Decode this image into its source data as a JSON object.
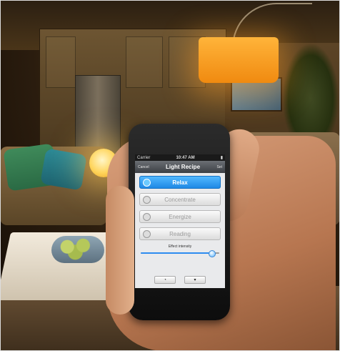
{
  "status_bar": {
    "carrier": "Carrier",
    "time": "10:47 AM"
  },
  "nav": {
    "left": "Cancel",
    "title": "Light Recipe",
    "right": "Set"
  },
  "recipes": [
    {
      "label": "Relax",
      "icon": "relax-icon",
      "active": true
    },
    {
      "label": "Concentrate",
      "icon": "concentrate-icon",
      "active": false
    },
    {
      "label": "Energize",
      "icon": "energize-icon",
      "active": false
    },
    {
      "label": "Reading",
      "icon": "reading-icon",
      "active": false
    }
  ],
  "effect_intensity": {
    "label": "Effect intensity",
    "value": 0.9
  },
  "toolbar": {
    "left_icon": "clock-icon",
    "right_icon": "bulb-icon"
  },
  "colors": {
    "active": "#2d8cf0",
    "navbar": "#4a4e53"
  }
}
